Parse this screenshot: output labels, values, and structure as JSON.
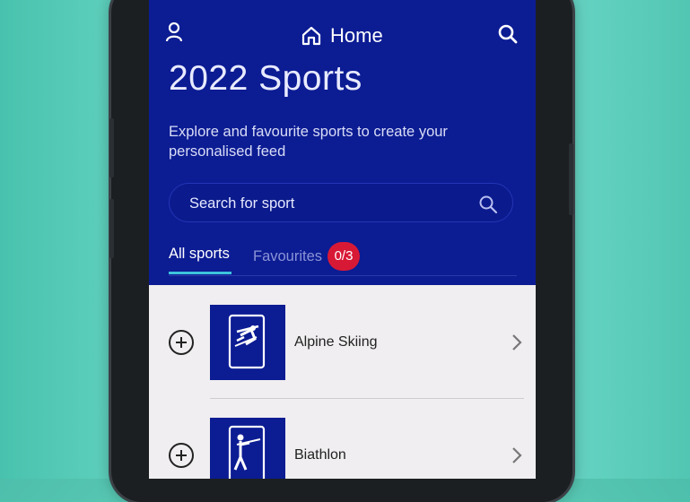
{
  "topbar": {
    "home_label": "Home",
    "profile_icon": "person-icon",
    "home_icon": "home-icon",
    "search_icon": "search-icon"
  },
  "page": {
    "title": "2022 Sports",
    "subtitle": "Explore and favourite sports to create your personalised feed"
  },
  "search": {
    "placeholder": "Search for sport",
    "value": ""
  },
  "tabs": {
    "all_label": "All sports",
    "favourites_label": "Favourites",
    "favourites_badge": "0/3"
  },
  "sports": [
    {
      "name": "Alpine Skiing",
      "icon": "alpine-skiing-pictogram"
    },
    {
      "name": "Biathlon",
      "icon": "biathlon-pictogram"
    }
  ],
  "colors": {
    "header_bg": "#0c1c93",
    "tab_underline": "#3dc3dd",
    "badge_bg": "#d81936",
    "list_bg": "#f0eef0"
  }
}
